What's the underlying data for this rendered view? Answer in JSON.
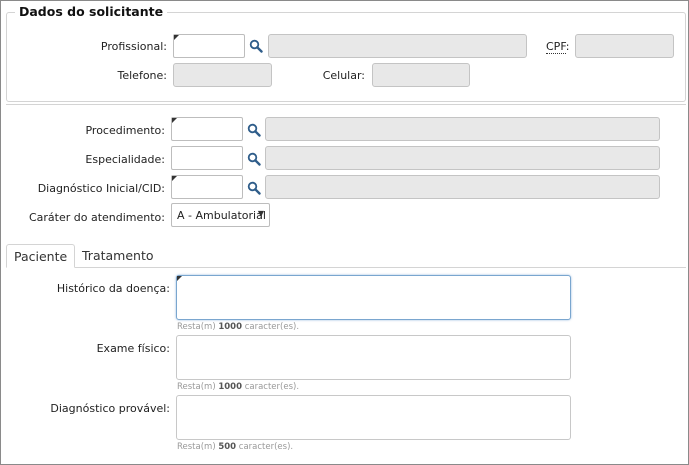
{
  "solicitante": {
    "legend": "Dados do solicitante",
    "profissional_label": "Profissional:",
    "cpf_label": "CPF",
    "cpf_suffix": ":",
    "telefone_label": "Telefone:",
    "celular_label": "Celular:"
  },
  "procedimento": {
    "procedimento_label": "Procedimento:",
    "especialidade_label": "Especialidade:",
    "diagnostico_label": "Diagnóstico Inicial/CID:",
    "carater_label": "Caráter do atendimento:",
    "carater_value": "A - Ambulatorial"
  },
  "tabs": [
    {
      "label": "Paciente"
    },
    {
      "label": "Tratamento"
    }
  ],
  "paciente": {
    "historico_label": "Histórico da doença:",
    "historico_hint_pre": "Resta(m) ",
    "historico_hint_count": "1000",
    "historico_hint_post": " caracter(es).",
    "exame_label": "Exame físico:",
    "exame_hint_pre": "Resta(m) ",
    "exame_hint_count": "1000",
    "exame_hint_post": " caracter(es).",
    "diagnostico_label": "Diagnóstico provável:",
    "diagnostico_hint_pre": "Resta(m) ",
    "diagnostico_hint_count": "500",
    "diagnostico_hint_post": " caracter(es)."
  },
  "icons": {
    "search": "magnifier-icon",
    "dropdown": "triangle-down"
  },
  "colors": {
    "readonly_bg": "#e8e8e8",
    "focus_border": "#7aa6cf",
    "hint_text": "#999999"
  }
}
